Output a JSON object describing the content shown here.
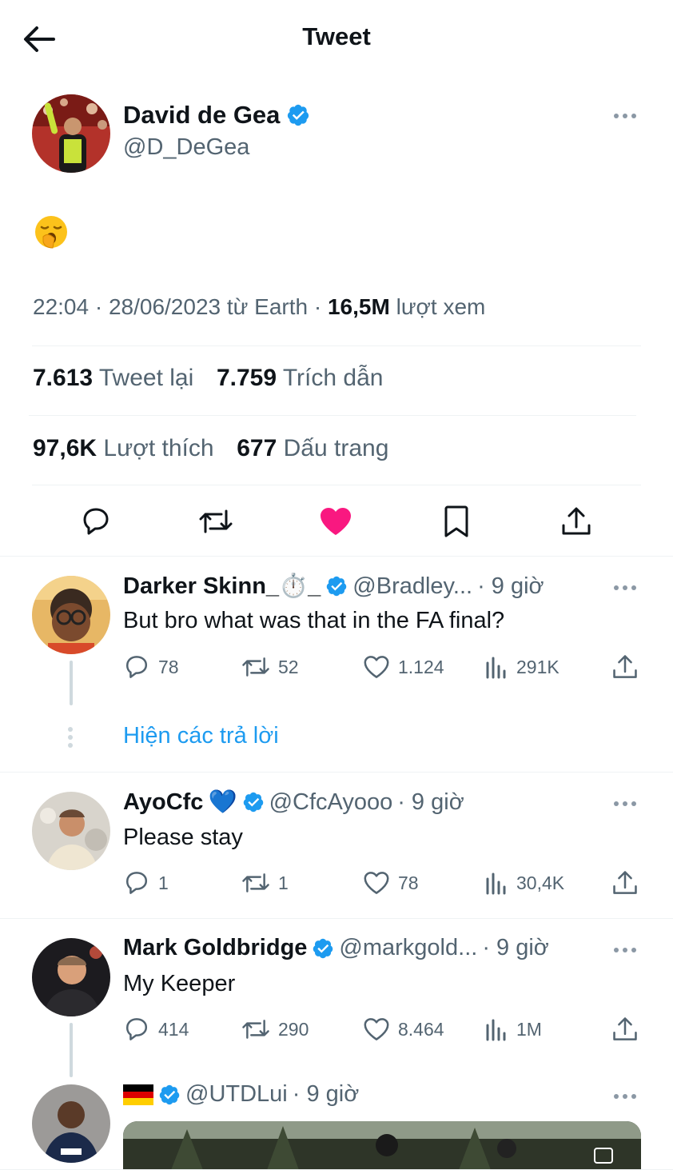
{
  "header": {
    "title": "Tweet",
    "back_icon": "arrow-left-icon"
  },
  "tweet": {
    "author_name": "David de Gea",
    "author_handle": "@D_DeGea",
    "content_emoji": "🥱",
    "time": "22:04 · 28/06/2023 từ Earth · ",
    "views_count": "16,5M",
    "views_label": " lượt xem",
    "retweets_count": "7.613",
    "retweets_label": " Tweet lại",
    "quotes_count": "7.759",
    "quotes_label": " Trích dẫn",
    "likes_count": "97,6K",
    "likes_label": " Lượt thích",
    "bookmarks_count": "677",
    "bookmarks_label": " Dấu trang"
  },
  "colors": {
    "accent": "#1d9bf0",
    "like": "#f91880",
    "muted": "#536471",
    "divider": "#eff3f4"
  },
  "replies": [
    {
      "name": "Darker Skinn_⏱️_",
      "handle": "@Bradley...",
      "time": "· 9 giờ",
      "text": "But bro what was that in the FA final?",
      "replies": "78",
      "retweets": "52",
      "likes": "1.124",
      "views": "291K"
    },
    {
      "name": "AyoCfc",
      "name_suffix": "💙",
      "handle": "@CfcAyooo",
      "time": "· 9 giờ",
      "text": "Please stay",
      "replies": "1",
      "retweets": "1",
      "likes": "78",
      "views": "30,4K"
    },
    {
      "name": "Mark Goldbridge",
      "handle": "@markgold...",
      "time": "· 9 giờ",
      "text": "My Keeper",
      "replies": "414",
      "retweets": "290",
      "likes": "8.464",
      "views": "1M"
    },
    {
      "name": "🇩🇪",
      "handle": "@UTDLui",
      "time": "· 9 giờ"
    }
  ],
  "show_replies_label": "Hiện các trả lời"
}
